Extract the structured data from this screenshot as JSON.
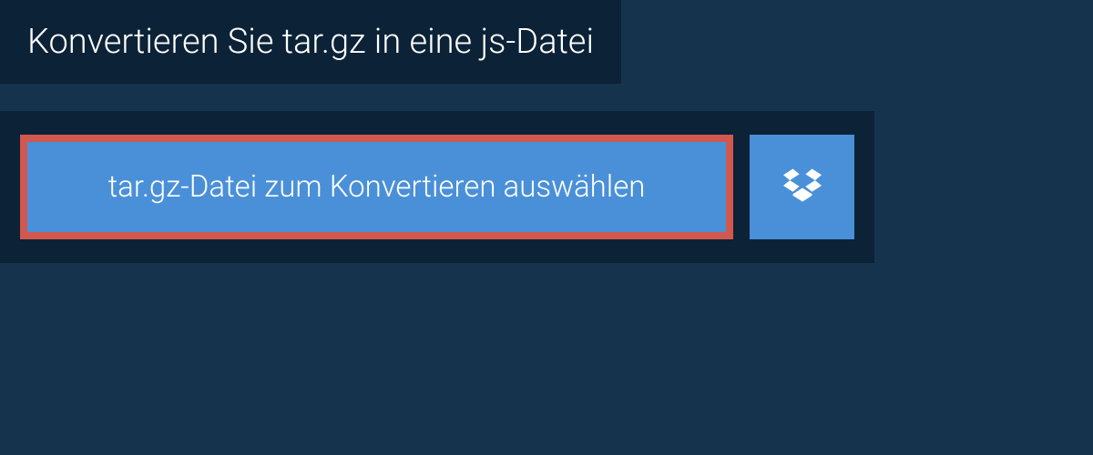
{
  "header": {
    "title": "Konvertieren Sie tar.gz in eine js-Datei"
  },
  "upload": {
    "select_file_label": "tar.gz-Datei zum Konvertieren auswählen"
  }
}
